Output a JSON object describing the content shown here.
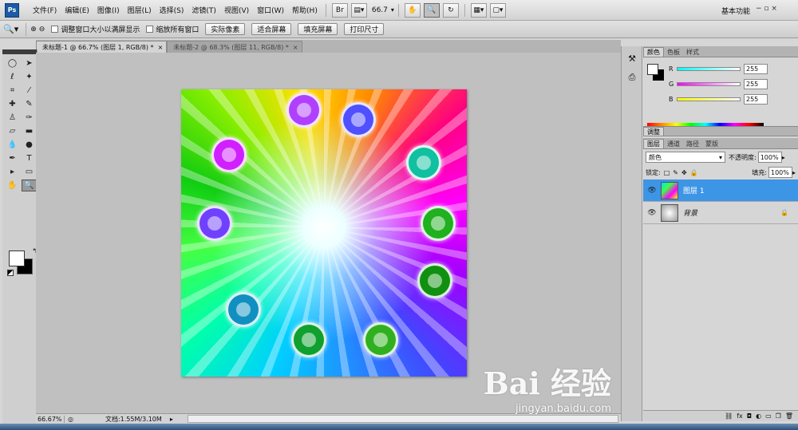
{
  "menubar": {
    "logo": "Ps",
    "items": [
      "文件(F)",
      "编辑(E)",
      "图像(I)",
      "图层(L)",
      "选择(S)",
      "滤镜(T)",
      "视图(V)",
      "窗口(W)",
      "帮助(H)"
    ],
    "br_label": "Br",
    "zoom": "66.7",
    "workspace": "基本功能",
    "win_controls": "−   ▫   ×"
  },
  "options": {
    "resize_windows": "调整窗口大小以满屏显示",
    "zoom_all": "缩放所有窗口",
    "actual_pixels": "实际像素",
    "fit_screen": "适合屏幕",
    "fill_screen": "填充屏幕",
    "print_size": "打印尺寸"
  },
  "tabs": [
    {
      "label": "未标题-1 @ 66.7% (图层 1, RGB/8) *",
      "close": "×"
    },
    {
      "label": "未标题-2 @ 68.3% (图层 11, RGB/8) *",
      "close": "×"
    }
  ],
  "watermark": {
    "logo": "Bai 经验",
    "url": "jingyan.baidu.com"
  },
  "status": {
    "zoom": "66.67%",
    "doc": "文档:1.55M/3.10M"
  },
  "color_panel": {
    "tabs": [
      "颜色",
      "色板",
      "样式"
    ],
    "channels": [
      {
        "label": "R",
        "value": "255"
      },
      {
        "label": "G",
        "value": "255"
      },
      {
        "label": "B",
        "value": "255"
      }
    ]
  },
  "adjust_tab": "调整",
  "layers_panel": {
    "tabs": [
      "图层",
      "通道",
      "路径",
      "蒙版"
    ],
    "blend_mode": "颜色",
    "opacity_label": "不透明度:",
    "opacity": "100%",
    "lock_label": "锁定:",
    "fill_label": "填充:",
    "fill": "100%",
    "layers": [
      {
        "name": "图层 1",
        "selected": true
      },
      {
        "name": "背景",
        "selected": false
      }
    ],
    "footer_icons": [
      "link-icon",
      "fx-icon",
      "mask-icon",
      "adjustment-icon",
      "group-icon",
      "new-layer-icon",
      "trash-icon"
    ]
  },
  "colors": {
    "selection": "#3d95e6",
    "ps_blue": "#1c5aa6"
  }
}
